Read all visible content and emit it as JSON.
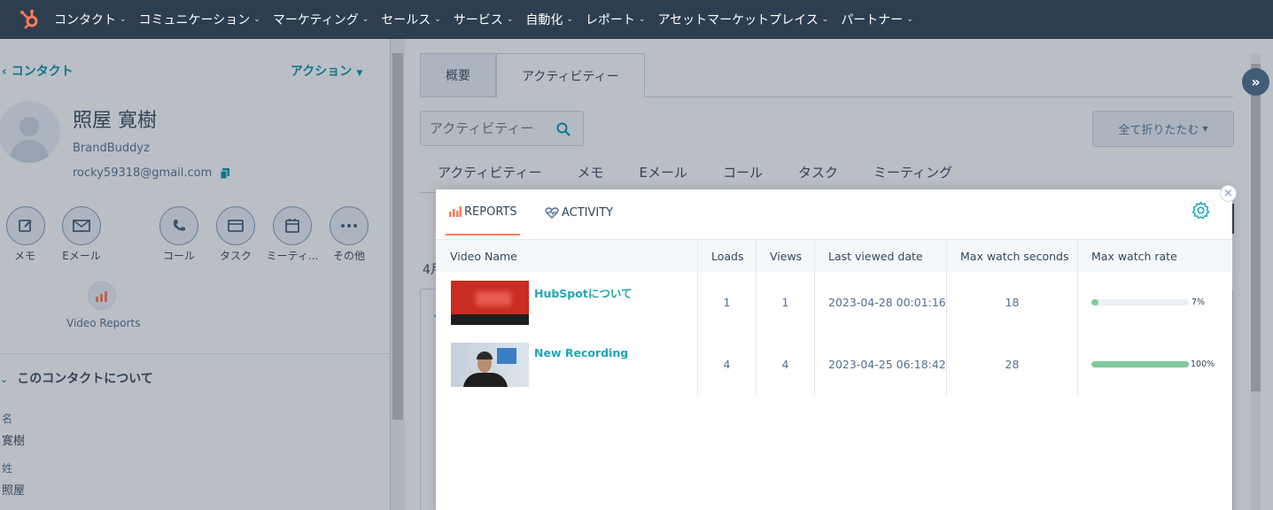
{
  "nav": {
    "items": [
      "コンタクト",
      "コミュニケーション",
      "マーケティング",
      "セールス",
      "サービス",
      "自動化",
      "レポート",
      "アセットマーケットプレイス",
      "パートナー"
    ]
  },
  "sidebar": {
    "back_label": "コンタクト",
    "actions_label": "アクション",
    "contact_name": "照屋 寛樹",
    "company": "BrandBuddyz",
    "email": "rocky59318@gmail.com",
    "quick_actions": [
      {
        "label": "メモ",
        "icon": "note-icon"
      },
      {
        "label": "Eメール",
        "icon": "email-icon"
      },
      {
        "label": "コール",
        "icon": "phone-icon"
      },
      {
        "label": "タスク",
        "icon": "task-icon"
      },
      {
        "label": "ミーティ...",
        "icon": "calendar-icon"
      },
      {
        "label": "その他",
        "icon": "more-icon"
      }
    ],
    "video_reports_label": "Video Reports",
    "about_heading": "このコンタクトについて",
    "properties": [
      {
        "label": "名",
        "value": "寛樹"
      },
      {
        "label": "姓",
        "value": "照屋"
      }
    ]
  },
  "main": {
    "tabs": [
      "概要",
      "アクティビティー"
    ],
    "search_placeholder": "アクティビティー",
    "collapse_label": "全て折りたたむ",
    "filter_tabs": [
      "アクティビティー",
      "メモ",
      "Eメール",
      "コール",
      "タスク",
      "ミーティング"
    ],
    "month_fragment": "4月"
  },
  "modal": {
    "tabs": [
      "REPORTS",
      "ACTIVITY"
    ],
    "columns": [
      "Video Name",
      "Loads",
      "Views",
      "Last viewed date",
      "Max watch seconds",
      "Max watch rate"
    ],
    "rows": [
      {
        "name": "HubSpotについて",
        "loads": "1",
        "views": "1",
        "last_viewed": "2023-04-28 00:01:16",
        "max_seconds": "18",
        "rate_label": "7%",
        "rate": 0.07
      },
      {
        "name": "New Recording",
        "loads": "4",
        "views": "4",
        "last_viewed": "2023-04-25 06:18:42",
        "max_seconds": "28",
        "rate_label": "100%",
        "rate": 1.0
      }
    ]
  },
  "colors": {
    "nav_bg": "#2d3e50",
    "link": "#0091ae",
    "accent_orange": "#ff7a59",
    "rate_fill": "#7fc99b",
    "video_link": "#1fa7b5"
  }
}
